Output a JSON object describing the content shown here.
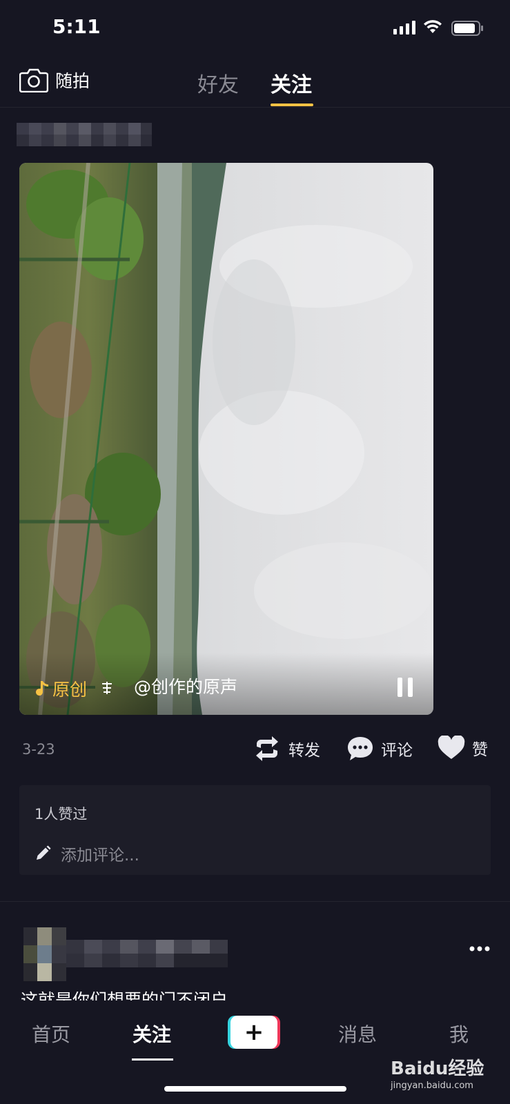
{
  "status_bar": {
    "time": "5:11"
  },
  "top_nav": {
    "camera_label": "随拍",
    "tabs": [
      {
        "label": "好友",
        "active": false
      },
      {
        "label": "关注",
        "active": true
      }
    ],
    "accent": "#f6c244"
  },
  "post": {
    "video": {
      "original_label": "原创",
      "sound_label": "@创作的原声",
      "state": "playing"
    },
    "date": "3-23",
    "actions": {
      "share_label": "转发",
      "comment_label": "评论",
      "like_label": "赞"
    },
    "likes_text": "1人赞过",
    "comment_placeholder": "添加评论..."
  },
  "next_post": {
    "caption": "这就是你们想要的门不闭户"
  },
  "bottom_bar": {
    "tabs": [
      {
        "label": "首页"
      },
      {
        "label": "关注",
        "active": true
      },
      {
        "label": "+"
      },
      {
        "label": "消息"
      },
      {
        "label": "我"
      }
    ]
  },
  "watermark": {
    "brand": "Baidu经验",
    "url": "jingyan.baidu.com"
  }
}
